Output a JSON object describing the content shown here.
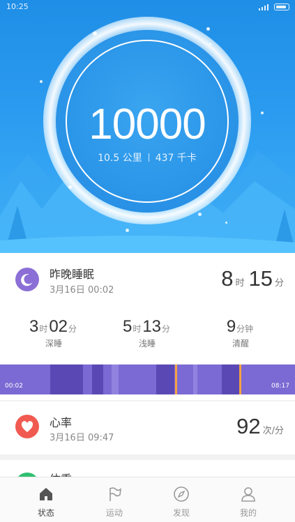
{
  "status_bar": {
    "time": "10:25"
  },
  "steps": {
    "count": "10000",
    "distance": "10.5 公里",
    "calories": "437 千卡"
  },
  "sleep": {
    "title": "昨晚睡眠",
    "date": "3月16日 00:02",
    "total_hours": "8",
    "hours_unit": "时",
    "total_minutes": "15",
    "minutes_unit": "分",
    "stats": [
      {
        "h": "3",
        "h_unit": "时",
        "m": "02",
        "m_unit": "分",
        "label": "深睡"
      },
      {
        "h": "5",
        "h_unit": "时",
        "m": "13",
        "m_unit": "分",
        "label": "浅睡"
      },
      {
        "m": "9",
        "m_unit": "分钟",
        "label": "清醒"
      }
    ],
    "bar_start": "00:02",
    "bar_end": "08:17",
    "colors": {
      "light": "#7b6ad3",
      "deep": "#5a48b4",
      "awake": "#f5a241",
      "mid": "#9282e0"
    }
  },
  "heart": {
    "title": "心率",
    "date": "3月16日 09:47",
    "value": "92",
    "unit": "次/分",
    "color": "#f05a50"
  },
  "weight": {
    "title": "体重",
    "color": "#2fbf71"
  },
  "nav": {
    "items": [
      {
        "label": "状态",
        "icon": "home-icon",
        "active": true
      },
      {
        "label": "运动",
        "icon": "flag-icon",
        "active": false
      },
      {
        "label": "发现",
        "icon": "compass-icon",
        "active": false
      },
      {
        "label": "我的",
        "icon": "person-icon",
        "active": false
      }
    ]
  },
  "colors": {
    "hero_top": "#1f8ee6",
    "hero_bottom": "#3fb1f7",
    "sleep_icon": "#8b6fd6"
  }
}
